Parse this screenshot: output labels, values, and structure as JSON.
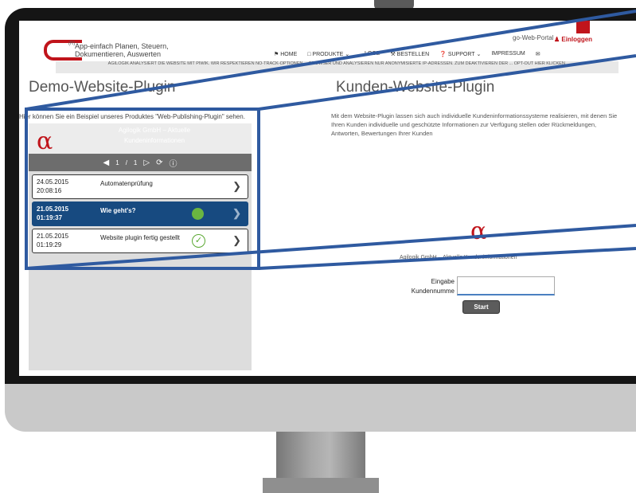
{
  "header": {
    "logo_sup": "(R)",
    "tagline": "App-einfach Planen, Steuern, Dokumentieren, Auswerten",
    "portal": "go-Web-Portal",
    "login": "Einloggen",
    "nav": [
      "HOME",
      "PRODUKTE",
      "BESTELLEN",
      "SUPPORT",
      "IMPRESSUM"
    ],
    "nav_partial": "...LOGE",
    "privacy_text": "AGILOGIK ANALYSIERT DIE WEBSITE MIT PIWIK. WIR RESPEKTIEREN NO-TRACK-OPTIONEN ... BROWSER UND ANALYSIEREN NUR ANONYMISIERTE IP-ADRESSEN. ZUM DEAKTIVIEREN DER ... OPT-OUT HIER KLICKEN."
  },
  "left": {
    "heading": "Demo-Website-Plugin",
    "intro": "Hier können Sie ein Beispiel unseres Produktes \"Web-Publishing-Plugin\" sehen.",
    "widget": {
      "company": "Agilogik GmbH – Aktuelle Kundeninformationen",
      "page_current": "1",
      "page_sep": "/",
      "page_total": "1",
      "rows": [
        {
          "date": "24.05.2015",
          "time": "20:08:16",
          "title": "Automatenprüfung",
          "status": "none"
        },
        {
          "date": "21.05.2015",
          "time": "01:19:37",
          "title": "Wie geht's?",
          "status": "green"
        },
        {
          "date": "21.05.2015",
          "time": "01:19:29",
          "title": "Website plugin fertig gestellt",
          "status": "check"
        }
      ]
    }
  },
  "right": {
    "heading": "Kunden-Website-Plugin",
    "intro": "Mit dem Website-Plugin lassen sich auch individuelle Kundeninformationssysteme realisieren, mit denen Sie Ihren Kunden individuelle und geschützte Informationen zur Verfügung stellen oder Rückmeldungen, Antworten, Bewertungen Ihrer Kunden",
    "info_label": "Agilogik GmbH – Aktuelle Kundeninformationen",
    "input_label_1": "Eingabe",
    "input_label_2": "Kundennumme",
    "start_button": "Start"
  },
  "colors": {
    "brand_red": "#c0141b",
    "active_row": "#174a80",
    "highlight_frame": "#2f5aa0",
    "status_green": "#6ab541"
  }
}
